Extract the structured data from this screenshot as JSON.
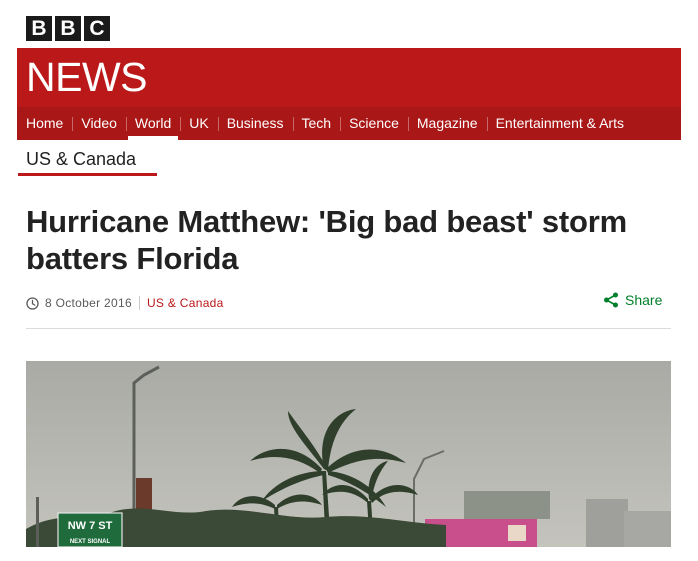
{
  "logo": {
    "letters": [
      "B",
      "B",
      "C"
    ]
  },
  "masthead": {
    "title": "NEWS",
    "color": "#bb1919"
  },
  "nav": {
    "items": [
      {
        "label": "Home",
        "active": false
      },
      {
        "label": "Video",
        "active": false
      },
      {
        "label": "World",
        "active": true
      },
      {
        "label": "UK",
        "active": false
      },
      {
        "label": "Business",
        "active": false
      },
      {
        "label": "Tech",
        "active": false
      },
      {
        "label": "Science",
        "active": false
      },
      {
        "label": "Magazine",
        "active": false
      },
      {
        "label": "Entertainment & Arts",
        "active": false
      }
    ]
  },
  "section": {
    "label": "US & Canada"
  },
  "article": {
    "headline": "Hurricane Matthew: 'Big bad beast' storm batters Florida",
    "date": "8 October 2016",
    "section_link": "US & Canada",
    "share_label": "Share"
  },
  "photo": {
    "sign_text": "NW 7 ST",
    "sign_subtext": "NEXT SIGNAL"
  },
  "icons": {
    "clock": "clock-icon",
    "share": "share-icon"
  },
  "colors": {
    "accent_red": "#bb1919",
    "share_green": "#00802b"
  }
}
